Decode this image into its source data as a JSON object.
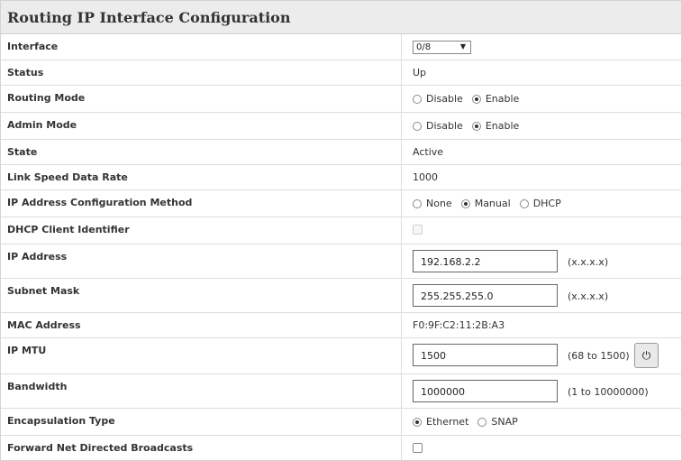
{
  "page": {
    "title": "Routing IP Interface Configuration"
  },
  "rows": {
    "interface": {
      "label": "Interface",
      "value": "0/8"
    },
    "status": {
      "label": "Status",
      "value": "Up"
    },
    "routing_mode": {
      "label": "Routing Mode",
      "options": [
        "Disable",
        "Enable"
      ],
      "selected": "Enable"
    },
    "admin_mode": {
      "label": "Admin Mode",
      "options": [
        "Disable",
        "Enable"
      ],
      "selected": "Enable"
    },
    "state": {
      "label": "State",
      "value": "Active"
    },
    "link_speed": {
      "label": "Link Speed Data Rate",
      "value": "1000"
    },
    "ip_method": {
      "label": "IP Address Configuration Method",
      "options": [
        "None",
        "Manual",
        "DHCP"
      ],
      "selected": "Manual"
    },
    "dhcp_client_id": {
      "label": "DHCP Client Identifier",
      "checked": false,
      "disabled": true
    },
    "ip_address": {
      "label": "IP Address",
      "value": "192.168.2.2",
      "hint": "(x.x.x.x)"
    },
    "subnet_mask": {
      "label": "Subnet Mask",
      "value": "255.255.255.0",
      "hint": "(x.x.x.x)"
    },
    "mac_address": {
      "label": "MAC Address",
      "value": "F0:9F:C2:11:2B:A3"
    },
    "ip_mtu": {
      "label": "IP MTU",
      "value": "1500",
      "hint": "(68 to 1500)",
      "button_icon": "power-icon"
    },
    "bandwidth": {
      "label": "Bandwidth",
      "value": "1000000",
      "hint": "(1 to 10000000)"
    },
    "encapsulation": {
      "label": "Encapsulation Type",
      "options": [
        "Ethernet",
        "SNAP"
      ],
      "selected": "Ethernet"
    },
    "forward_broadcasts": {
      "label": "Forward Net Directed Broadcasts",
      "checked": false
    }
  }
}
